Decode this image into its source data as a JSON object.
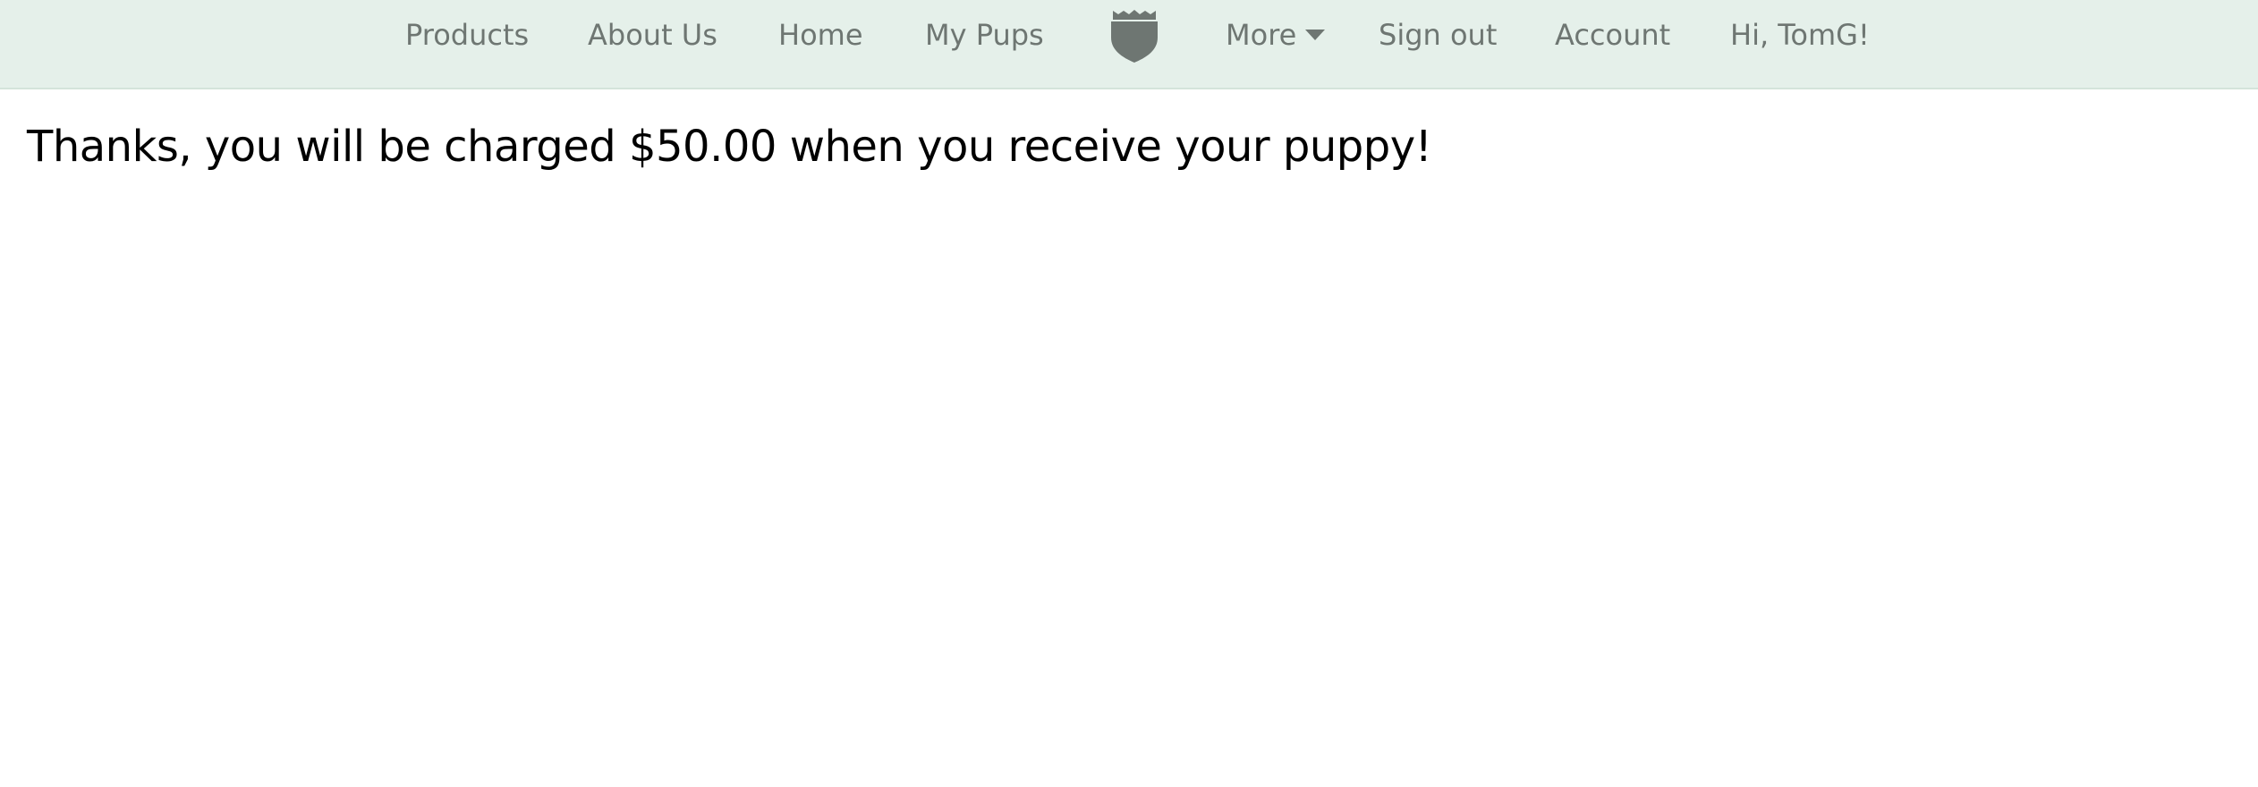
{
  "nav": {
    "products_label": "Products",
    "about_label": "About Us",
    "home_label": "Home",
    "mypups_label": "My Pups",
    "logo_icon": "shield-icon",
    "more_label": "More",
    "signout_label": "Sign out",
    "account_label": "Account",
    "greeting": "Hi, TomG!"
  },
  "main": {
    "message": "Thanks, you will be charged $50.00 when you receive your puppy!"
  },
  "colors": {
    "navbar_background": "#e5f0ea",
    "nav_text": "#6e7672",
    "message_text": "#000000"
  }
}
